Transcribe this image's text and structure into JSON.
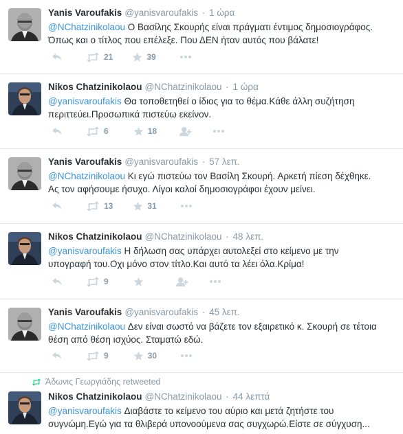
{
  "tweets": [
    {
      "name": "Yanis Varoufakis",
      "handle": "@yanisvaroufakis",
      "time": "1 ώρα",
      "mention": "@NChatzinikolaou",
      "line1": " Ο Βασίλης Σκουρής είναι πράγματι έντιμος δημοσιογράφος.",
      "line2": "Όπως και ο τίτλος που επέλεξε. Που ΔΕΝ ήταν αυτός που βάλατε!",
      "retweets": "21",
      "favorites": "39",
      "avatar": "varoufakis"
    },
    {
      "name": "Nikos Chatzinikolaou",
      "handle": "@NChatzinikolaou",
      "time": "1 ώρα",
      "mention": "@yanisvaroufakis",
      "line1": " Θα τοποθετηθεί ο ίδιος για το θέμα.Κάθε άλλη συζήτηση",
      "line2": "περιττεύει.Προσωπικά πιστεύω εκείνον.",
      "retweets": "6",
      "favorites": "18",
      "avatar": "chatzinikolaou"
    },
    {
      "name": "Yanis Varoufakis",
      "handle": "@yanisvaroufakis",
      "time": "57 λεπ.",
      "mention": "@NChatzinikolaou",
      "line1": " Κι εγώ πιστεύω τον Βασίλη Σκουρή. Αρκετή πίεση δέχθηκε.",
      "line2": "Ας τον αφήσουμε ήσυχο. Λίγοι καλοί δημοσιογράφοι έχουν μείνει.",
      "retweets": "13",
      "favorites": "31",
      "avatar": "varoufakis"
    },
    {
      "name": "Nikos Chatzinikolaou",
      "handle": "@NChatzinikolaou",
      "time": "48 λεπ.",
      "mention": "@yanisvaroufakis",
      "line1": " Η δήλωση σας υπάρχει αυτολεξεί στο κείμενο με την",
      "line2": "υπογραφή του.Οχι μόνο στον τίτλο.Και αυτό τα λέει όλα.Κρίμα!",
      "retweets": "9",
      "favorites": "",
      "avatar": "chatzinikolaou"
    },
    {
      "name": "Yanis Varoufakis",
      "handle": "@yanisvaroufakis",
      "time": "45 λεπ.",
      "mention": "@NChatzinikolaou",
      "line1": " Δεν είναι σωστό να βάζετε τον εξαιρετικό κ. Σκουρή σε τέτοια",
      "line2": "θέση από θέση ισχύος. Σταματώ εδώ.",
      "retweets": "9",
      "favorites": "30",
      "avatar": "varoufakis"
    },
    {
      "retweeted_by": "Άδωνις Γεωργιάδης retweeted",
      "name": "Nikos Chatzinikolaou",
      "handle": "@NChatzinikolaou",
      "time": "44 λεπτά",
      "mention": "@yanisvaroufakis",
      "line1": " Διαβάστε το κείμενο του αύριο και μετά ζητήστε του",
      "line2": "συγνώμη.Εγώ για τα θλιβερά υπονοούμενα σας συγχωρώ.Είστε σε σύγχυση...",
      "avatar": "chatzinikolaou"
    }
  ],
  "colors": {
    "mention": "#3b94d9",
    "meta": "#8899a6",
    "text": "#292f33",
    "divider": "#e1e8ed",
    "retweet_green": "#19cf86"
  }
}
